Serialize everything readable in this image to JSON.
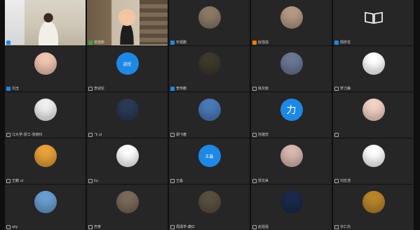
{
  "meeting": {
    "tiles": [
      {
        "label": "韩琳",
        "kind": "video-a",
        "mic": "blue",
        "avatar_color": "#d9d4c8",
        "active": false
      },
      {
        "label": "梁建新",
        "kind": "video-b",
        "mic": "green",
        "avatar_color": "#c9bca8",
        "active": true
      },
      {
        "label": "宇源鹏",
        "kind": "avatar",
        "mic": "blue",
        "avatar_color": "#8c7a66",
        "avatar_text": "",
        "icon": "horse-rider-icon"
      },
      {
        "label": "赵强强",
        "kind": "avatar",
        "mic": "orange",
        "avatar_color": "#b59a84",
        "avatar_text": "",
        "icon": "portrait-icon"
      },
      {
        "label": "郭彦龙",
        "kind": "avatar",
        "mic": "blue",
        "avatar_color": "#ffffff",
        "avatar_text": "",
        "icon": "book-icon"
      },
      {
        "label": "刘玉",
        "kind": "avatar",
        "mic": "blue",
        "avatar_color": "#f3c6b1",
        "avatar_text": "",
        "icon": "cartoon-face-icon"
      },
      {
        "label": "李迎伦",
        "kind": "avatar",
        "mic": "off",
        "avatar_color": "#1e88e5",
        "avatar_text": "迎伦",
        "icon": "text-avatar"
      },
      {
        "label": "李传鹏",
        "kind": "avatar",
        "mic": "blue",
        "avatar_color": "#3d3a2c",
        "avatar_text": "",
        "icon": "painting-icon"
      },
      {
        "label": "徐文晓",
        "kind": "avatar",
        "mic": "off",
        "avatar_color": "#6b7894",
        "avatar_text": "",
        "icon": "group-photo-icon"
      },
      {
        "label": "罗力静",
        "kind": "avatar",
        "mic": "off",
        "avatar_color": "#ffffff",
        "avatar_text": "",
        "icon": "panda-icon"
      },
      {
        "label": "江大学-浙工-张晓玲",
        "kind": "avatar",
        "mic": "off",
        "avatar_color": "#f0f0f0",
        "avatar_text": "",
        "icon": "sketch-icon"
      },
      {
        "label": "飞 ul",
        "kind": "avatar",
        "mic": "off",
        "avatar_color": "#2a3a55",
        "avatar_text": "",
        "icon": "night-sky-icon"
      },
      {
        "label": "胡飞春",
        "kind": "avatar",
        "mic": "off",
        "avatar_color": "#4a7ab8",
        "avatar_text": "",
        "icon": "sky-icon"
      },
      {
        "label": "孙建忠",
        "kind": "avatar",
        "mic": "off",
        "avatar_color": "#1e88e5",
        "avatar_text": "力",
        "icon": "text-avatar"
      },
      {
        "label": "",
        "kind": "avatar",
        "mic": "off",
        "avatar_color": "#f2d3c6",
        "avatar_text": "",
        "icon": "girl-portrait-icon"
      },
      {
        "label": "王鹏 ul",
        "kind": "avatar",
        "mic": "off",
        "avatar_color": "#e8a23a",
        "avatar_text": "",
        "icon": "anime-icon"
      },
      {
        "label": "liu",
        "kind": "avatar",
        "mic": "off",
        "avatar_color": "#ffffff",
        "avatar_text": "",
        "icon": "panda-icon"
      },
      {
        "label": "王淼",
        "kind": "avatar",
        "mic": "off",
        "avatar_color": "#1e88e5",
        "avatar_text": "王淼",
        "icon": "text-avatar"
      },
      {
        "label": "贾文纵",
        "kind": "avatar",
        "mic": "off",
        "avatar_color": "#d8b8b0",
        "avatar_text": "",
        "icon": "baby-icon"
      },
      {
        "label": "刘志浩",
        "kind": "avatar",
        "mic": "off",
        "avatar_color": "#ffffff",
        "avatar_text": "",
        "icon": "flower-sketch-icon"
      },
      {
        "label": "wly",
        "kind": "avatar",
        "mic": "off",
        "avatar_color": "#6a9fd0",
        "avatar_text": "",
        "icon": "landscape-icon"
      },
      {
        "label": "齐奇",
        "kind": "avatar",
        "mic": "off",
        "avatar_color": "#7a6a5a",
        "avatar_text": "",
        "icon": "robot-icon"
      },
      {
        "label": "周潇学-康红",
        "kind": "avatar",
        "mic": "off",
        "avatar_color": "#5a5040",
        "avatar_text": "",
        "icon": "sunset-figure-icon"
      },
      {
        "label": "赵强强",
        "kind": "avatar",
        "mic": "off",
        "avatar_color": "#1a2a4a",
        "avatar_text": "",
        "icon": "galaxy-icon"
      },
      {
        "label": "许仁杰",
        "kind": "avatar",
        "mic": "off",
        "avatar_color": "#b8862a",
        "avatar_text": "",
        "icon": "temple-icon"
      }
    ]
  }
}
